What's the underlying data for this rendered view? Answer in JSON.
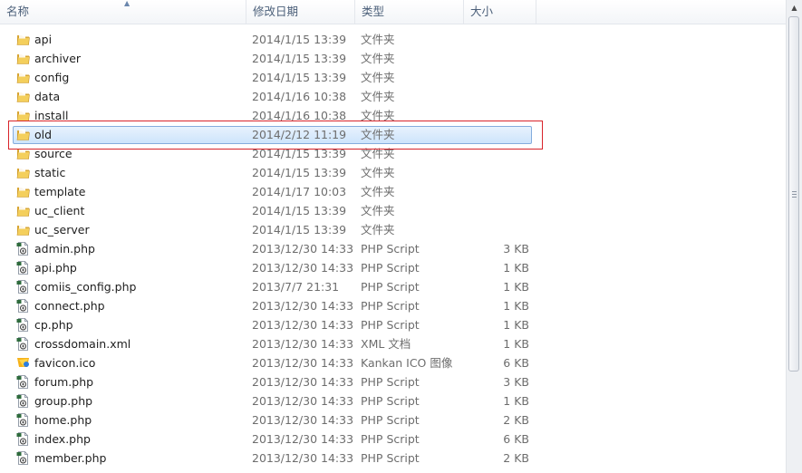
{
  "columns": {
    "name": "名称",
    "modified": "修改日期",
    "type": "类型",
    "size": "大小"
  },
  "sort_indicator": "name-ascending",
  "accent": {
    "selection_border": "#84acdd",
    "highlight_box": "#d8232a",
    "folder": "#e8b93a"
  },
  "files": [
    {
      "name": "api",
      "modified": "2014/1/15 13:39",
      "type": "文件夹",
      "size": "",
      "icon": "folder-icon"
    },
    {
      "name": "archiver",
      "modified": "2014/1/15 13:39",
      "type": "文件夹",
      "size": "",
      "icon": "folder-icon"
    },
    {
      "name": "config",
      "modified": "2014/1/15 13:39",
      "type": "文件夹",
      "size": "",
      "icon": "folder-icon"
    },
    {
      "name": "data",
      "modified": "2014/1/16 10:38",
      "type": "文件夹",
      "size": "",
      "icon": "folder-icon"
    },
    {
      "name": "install",
      "modified": "2014/1/16 10:38",
      "type": "文件夹",
      "size": "",
      "icon": "folder-icon"
    },
    {
      "name": "old",
      "modified": "2014/2/12 11:19",
      "type": "文件夹",
      "size": "",
      "icon": "folder-icon",
      "selected": true
    },
    {
      "name": "source",
      "modified": "2014/1/15 13:39",
      "type": "文件夹",
      "size": "",
      "icon": "folder-icon"
    },
    {
      "name": "static",
      "modified": "2014/1/15 13:39",
      "type": "文件夹",
      "size": "",
      "icon": "folder-icon"
    },
    {
      "name": "template",
      "modified": "2014/1/17 10:03",
      "type": "文件夹",
      "size": "",
      "icon": "folder-icon"
    },
    {
      "name": "uc_client",
      "modified": "2014/1/15 13:39",
      "type": "文件夹",
      "size": "",
      "icon": "folder-icon"
    },
    {
      "name": "uc_server",
      "modified": "2014/1/15 13:39",
      "type": "文件夹",
      "size": "",
      "icon": "folder-icon"
    },
    {
      "name": "admin.php",
      "modified": "2013/12/30 14:33",
      "type": "PHP Script",
      "size": "3 KB",
      "icon": "php-file-icon"
    },
    {
      "name": "api.php",
      "modified": "2013/12/30 14:33",
      "type": "PHP Script",
      "size": "1 KB",
      "icon": "php-file-icon"
    },
    {
      "name": "comiis_config.php",
      "modified": "2013/7/7 21:31",
      "type": "PHP Script",
      "size": "1 KB",
      "icon": "php-file-icon"
    },
    {
      "name": "connect.php",
      "modified": "2013/12/30 14:33",
      "type": "PHP Script",
      "size": "1 KB",
      "icon": "php-file-icon"
    },
    {
      "name": "cp.php",
      "modified": "2013/12/30 14:33",
      "type": "PHP Script",
      "size": "1 KB",
      "icon": "php-file-icon"
    },
    {
      "name": "crossdomain.xml",
      "modified": "2013/12/30 14:33",
      "type": "XML 文档",
      "size": "1 KB",
      "icon": "xml-file-icon"
    },
    {
      "name": "favicon.ico",
      "modified": "2013/12/30 14:33",
      "type": "Kankan ICO 图像",
      "size": "6 KB",
      "icon": "image-file-icon"
    },
    {
      "name": "forum.php",
      "modified": "2013/12/30 14:33",
      "type": "PHP Script",
      "size": "3 KB",
      "icon": "php-file-icon"
    },
    {
      "name": "group.php",
      "modified": "2013/12/30 14:33",
      "type": "PHP Script",
      "size": "1 KB",
      "icon": "php-file-icon"
    },
    {
      "name": "home.php",
      "modified": "2013/12/30 14:33",
      "type": "PHP Script",
      "size": "2 KB",
      "icon": "php-file-icon"
    },
    {
      "name": "index.php",
      "modified": "2013/12/30 14:33",
      "type": "PHP Script",
      "size": "6 KB",
      "icon": "php-file-icon"
    },
    {
      "name": "member.php",
      "modified": "2013/12/30 14:33",
      "type": "PHP Script",
      "size": "2 KB",
      "icon": "php-file-icon"
    }
  ]
}
